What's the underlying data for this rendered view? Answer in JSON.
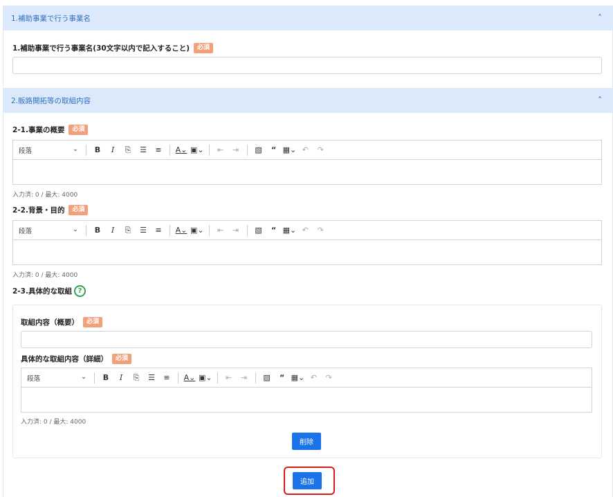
{
  "sections": [
    {
      "title": "1.補助事業で行う事業名"
    },
    {
      "title": "2.販路開拓等の取組内容"
    }
  ],
  "required_badge": "必須",
  "fields": {
    "project_name": {
      "label": "1.補助事業で行う事業名(30文字以内で記入すること)",
      "value": ""
    },
    "overview": {
      "label": "2-1.事業の概要",
      "counter": "入力済: 0 / 最大: 4000"
    },
    "background": {
      "label": "2-2.背景・目的",
      "counter": "入力済: 0 / 最大: 4000"
    },
    "concrete": {
      "label": "2-3.具体的な取組"
    },
    "item_summary": {
      "label": "取組内容（概要）",
      "value": ""
    },
    "item_detail": {
      "label": "具体的な取組内容（詳細）",
      "counter": "入力済: 0 / 最大: 4000"
    }
  },
  "toolbar": {
    "paragraph": "段落",
    "icons": [
      "bold-icon",
      "italic-icon",
      "link-icon",
      "bulleted-list-icon",
      "numbered-list-icon",
      "font-color-icon",
      "highlight-icon",
      "outdent-icon",
      "indent-icon",
      "image-icon",
      "quote-icon",
      "table-icon",
      "undo-icon",
      "redo-icon"
    ]
  },
  "buttons": {
    "delete": "削除",
    "add": "追加"
  },
  "colors": {
    "header_bg": "#dbe9fb",
    "header_text": "#2f6fc2",
    "required": "#f2a07b",
    "primary": "#1a73e8",
    "highlight": "#d81b1b",
    "help": "#2ea44f"
  }
}
